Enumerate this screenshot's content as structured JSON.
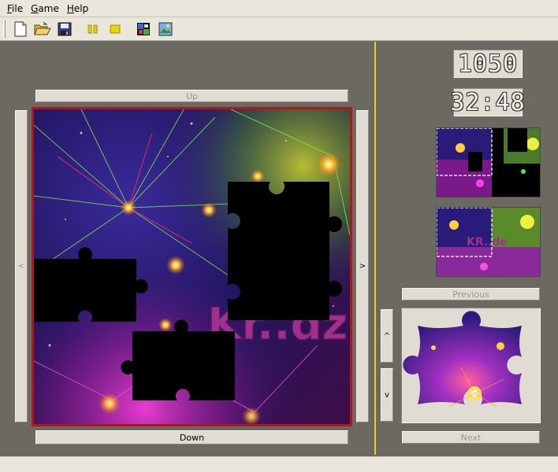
{
  "menubar": {
    "items": [
      {
        "accel": "F",
        "rest": "ile"
      },
      {
        "accel": "G",
        "rest": "ame"
      },
      {
        "accel": "H",
        "rest": "elp"
      }
    ]
  },
  "toolbar": {
    "icons": [
      "new-file-icon",
      "open-folder-icon",
      "save-icon",
      "pause-icon",
      "stop-icon",
      "show-solution-icon",
      "show-picture-icon"
    ]
  },
  "board": {
    "up_label": "Up",
    "down_label": "Down",
    "left_label": "<",
    "right_label": ">",
    "logo_text": "Kr..dz"
  },
  "status": {
    "score": "1050",
    "time": "32:48"
  },
  "preview": {
    "logo_text": "KR..de"
  },
  "pieces": {
    "previous_label": "Previous",
    "next_label": "Next",
    "up_label": "^",
    "down_label": "v"
  },
  "colors": {
    "frame": "#b01818",
    "divider": "#e6d21a",
    "panel_bg": "#6b6962",
    "widget_bg": "#e0dcd2"
  }
}
